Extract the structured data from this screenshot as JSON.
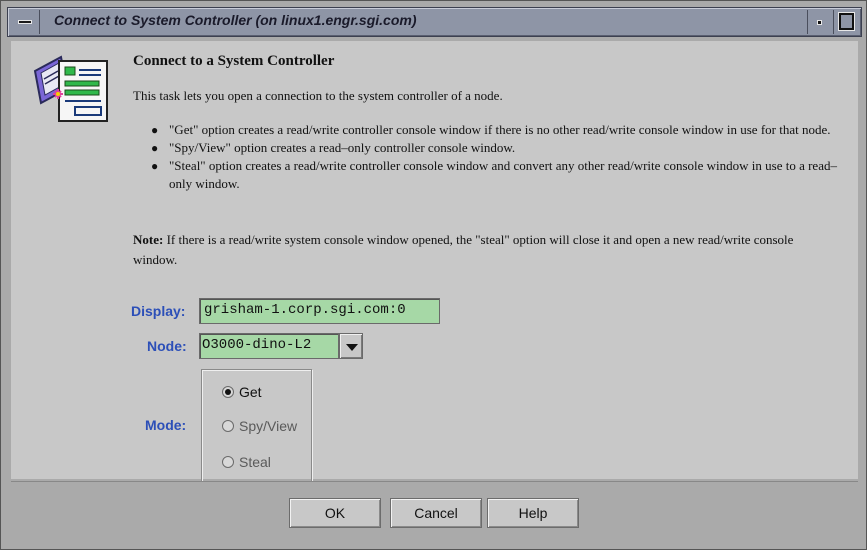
{
  "window": {
    "title": "Connect to System Controller (on linux1.engr.sgi.com)"
  },
  "task": {
    "heading": "Connect to a System Controller",
    "intro": "This task lets you open a connection to the system controller of a node.",
    "bullets": [
      "\"Get\" option creates a read/write controller console window if there is no other read/write console window in use for that node.",
      "\"Spy/View\" option creates a read–only controller console window.",
      "\"Steal\" option creates a read/write controller console window and convert any other read/write console window in use to a read–only window."
    ],
    "note_label": "Note:",
    "note_text": "If there is a read/write system console window opened, the \"steal\" option will close it and open a new read/write console window."
  },
  "form": {
    "display_label": "Display:",
    "display_value": "grisham-1.corp.sgi.com:0",
    "node_label": "Node:",
    "node_value": "O3000-dino-L2",
    "mode_label": "Mode:",
    "mode_options": [
      "Get",
      "Spy/View",
      "Steal"
    ],
    "mode_selected": "Get"
  },
  "buttons": {
    "ok": "OK",
    "cancel": "Cancel",
    "help": "Help"
  },
  "colors": {
    "field_label": "#2c4fb8",
    "input_background": "#a6d8a6",
    "titlebar": "#8e95a6"
  },
  "icons": [
    "window-menu-icon",
    "minimize-icon",
    "maximize-icon",
    "task-connect-icon",
    "dropdown-arrow-icon"
  ]
}
